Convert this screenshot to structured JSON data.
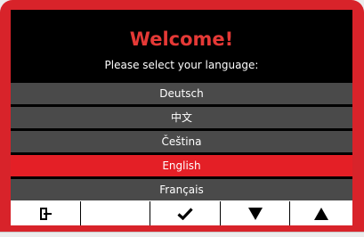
{
  "screen": {
    "title": "Welcome!",
    "subtitle": "Please select your language:"
  },
  "languages": [
    {
      "label": "Deutsch",
      "selected": false
    },
    {
      "label": "中文",
      "selected": false
    },
    {
      "label": "Čeština",
      "selected": false
    },
    {
      "label": "English",
      "selected": true
    },
    {
      "label": "Français",
      "selected": false
    }
  ],
  "softkeys": [
    {
      "icon": "exit-door-icon"
    },
    {
      "icon": ""
    },
    {
      "icon": "checkmark-icon"
    },
    {
      "icon": "arrow-down-icon"
    },
    {
      "icon": "arrow-up-icon"
    }
  ],
  "colors": {
    "bezel": "#d8232a",
    "title": "#e53936",
    "selected_row": "#e41f26",
    "row": "#4a4a4a",
    "screen_bg": "#000000",
    "softkey_bg": "#ffffff"
  }
}
